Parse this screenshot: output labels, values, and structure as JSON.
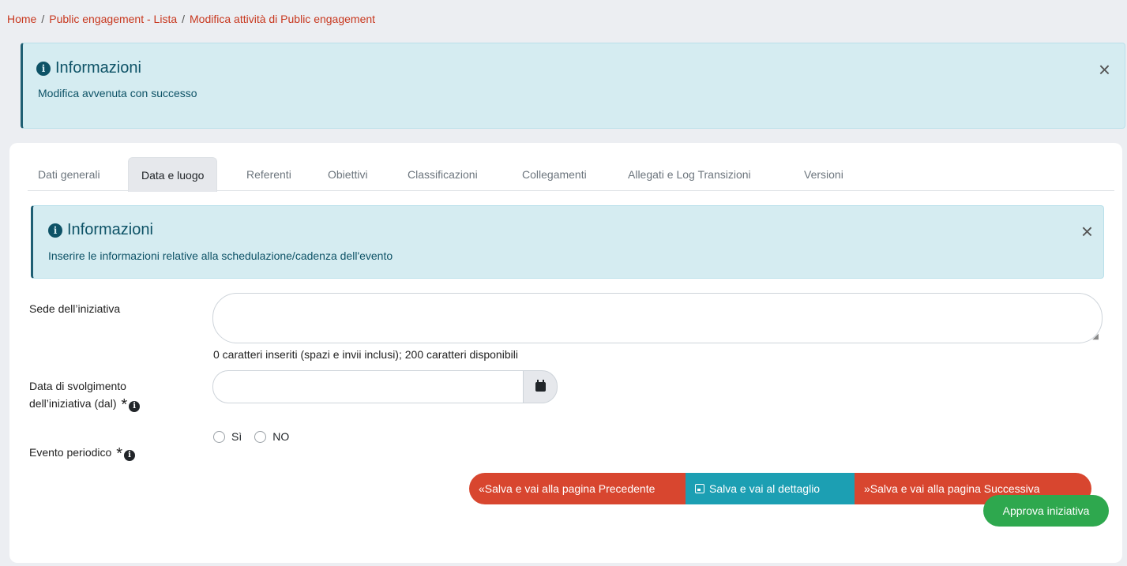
{
  "breadcrumb": {
    "items": [
      "Home",
      "Public engagement - Lista",
      "Modifica attività di Public engagement"
    ],
    "separator": "/"
  },
  "top_alert": {
    "title": "Informazioni",
    "message": "Modifica avvenuta con successo",
    "close": "×",
    "info_icon": "i"
  },
  "tabs": [
    {
      "label": "Dati generali",
      "active": false
    },
    {
      "label": "Data e luogo",
      "active": true
    },
    {
      "label": "Referenti",
      "active": false
    },
    {
      "label": "Obiettivi",
      "active": false
    },
    {
      "label": "Classificazioni",
      "active": false
    },
    {
      "label": "Collegamenti",
      "active": false
    },
    {
      "label": "Allegati e Log Transizioni",
      "active": false
    },
    {
      "label": "Versioni",
      "active": false
    }
  ],
  "inner_alert": {
    "title": "Informazioni",
    "message": "Inserire le informazioni relative alla schedulazione/cadenza dell'evento",
    "close": "×",
    "info_icon": "i"
  },
  "form": {
    "sede_label": "Sede dell’iniziativa",
    "sede_value": "",
    "sede_counter": "0 caratteri inseriti (spazi e invii inclusi); 200 caratteri disponibili",
    "data_label_line1": "Data di svolgimento",
    "data_label_line2": "dell’iniziativa (dal)",
    "data_value": "",
    "periodico_label": "Evento periodico",
    "required_mark": "*",
    "info_glyph": "i",
    "radio_si": "Sì",
    "radio_no": "NO"
  },
  "buttons": {
    "prev": "«Salva e vai alla pagina Precedente",
    "detail": "Salva e vai al dettaglio",
    "next": "»Salva e vai alla pagina Successiva",
    "approve": "Approva iniziativa"
  },
  "colors": {
    "link": "#c8381f",
    "alert_bg": "#d5ecf1",
    "alert_text": "#0d5266",
    "btn_red": "#d8462f",
    "btn_teal": "#1c9fb3",
    "btn_green": "#2ea84e"
  }
}
